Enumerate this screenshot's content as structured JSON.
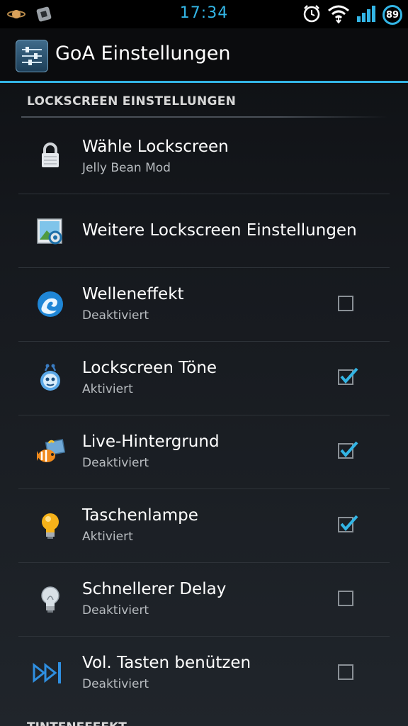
{
  "status_bar": {
    "time": "17:34",
    "battery_level": "89",
    "accent_color": "#33b5e5",
    "icons_left": [
      "planet-icon",
      "game-icon"
    ],
    "icons_right": [
      "alarm-icon",
      "wifi-icon",
      "signal-icon",
      "battery-icon"
    ]
  },
  "action_bar": {
    "title": "GoA Einstellungen",
    "icon": "settings-sliders-icon"
  },
  "sections": [
    {
      "header": "LOCKSCREEN EINSTELLUNGEN"
    },
    {
      "header": "TINTENEFFEKT"
    }
  ],
  "items": [
    {
      "title": "Wähle Lockscreen",
      "summary": "Jelly Bean Mod",
      "icon": "padlock-icon"
    },
    {
      "title": "Weitere Lockscreen Einstellungen",
      "summary": "",
      "icon": "picture-settings-icon"
    },
    {
      "title": "Welleneffekt",
      "summary": "Deaktiviert",
      "icon": "wave-icon",
      "checked": false
    },
    {
      "title": "Lockscreen Töne",
      "summary": "Aktiviert",
      "icon": "sound-robot-icon",
      "checked": true
    },
    {
      "title": "Live-Hintergrund",
      "summary": "Deaktiviert",
      "icon": "live-wallpaper-icon",
      "checked": true
    },
    {
      "title": "Taschenlampe",
      "summary": "Aktiviert",
      "icon": "lightbulb-on-icon",
      "checked": true
    },
    {
      "title": "Schnellerer Delay",
      "summary": "Deaktiviert",
      "icon": "lightbulb-off-icon",
      "checked": false
    },
    {
      "title": "Vol. Tasten benützen",
      "summary": "Deaktiviert",
      "icon": "skip-forward-icon",
      "checked": false
    }
  ]
}
